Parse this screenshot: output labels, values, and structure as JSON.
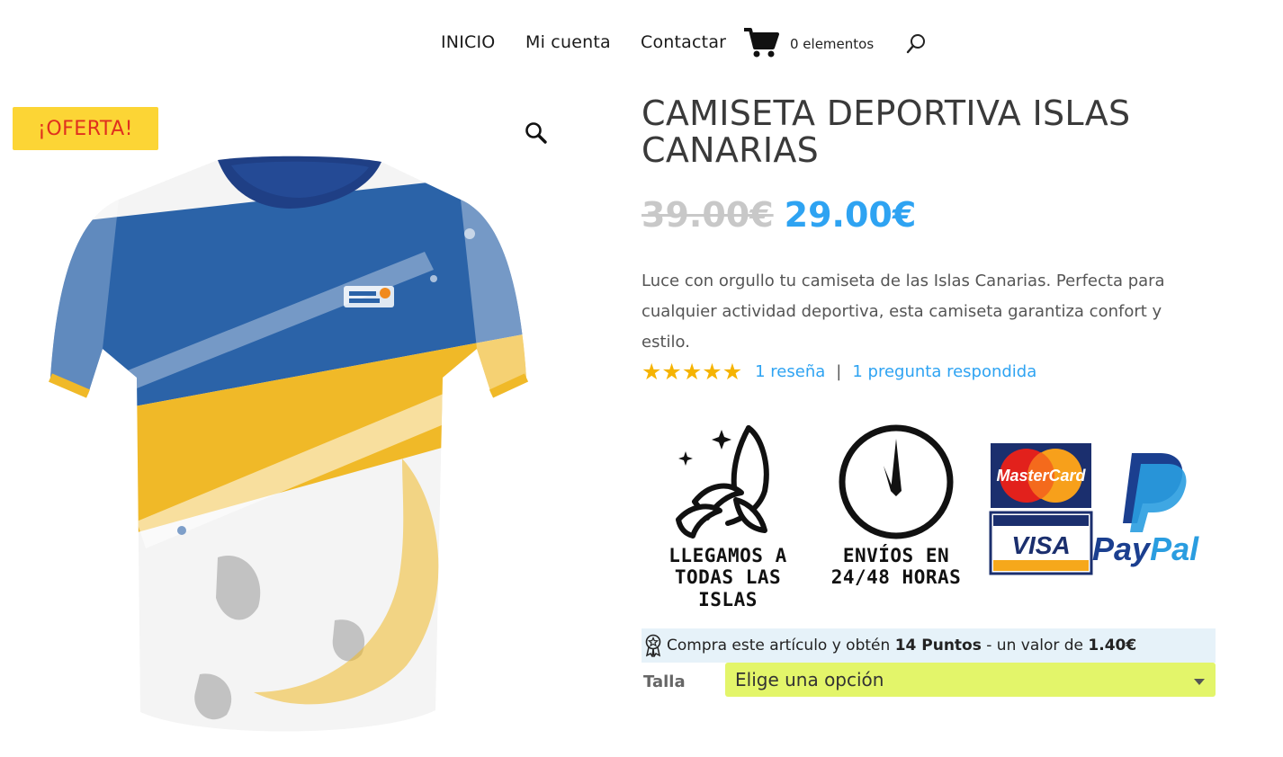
{
  "nav": {
    "items": [
      "INICIO",
      "Mi cuenta",
      "Contactar"
    ],
    "cart_count": "0 elementos"
  },
  "product": {
    "sale_badge": "¡OFERTA!",
    "title": "CAMISETA DEPORTIVA ISLAS CANARIAS",
    "price_old": "39.00€",
    "price_new": "29.00€",
    "description": "Luce con orgullo tu camiseta de las Islas Canarias. Perfecta para cualquier actividad deportiva, esta camiseta garantiza confort y estilo.",
    "rating": 5,
    "reviews_link": "1 reseña",
    "separator": "|",
    "questions_link": "1 pregunta respondida"
  },
  "badges": {
    "islands_line1": "LLEGAMOS A",
    "islands_line2": "TODAS LAS ISLAS",
    "shipping_line1": "ENVÍOS EN",
    "shipping_line2": "24/48 HORAS",
    "mastercard": "MasterCard",
    "visa": "VISA",
    "paypal_pay": "Pay",
    "paypal_pal": "Pal"
  },
  "points": {
    "prefix": "Compra este artículo y obtén ",
    "points": "14 Puntos",
    "middle": " - un valor de ",
    "value": "1.40€"
  },
  "variation": {
    "label": "Talla",
    "selected": "Elige una opción"
  },
  "colors": {
    "accent": "#2ea3f2",
    "sale_bg": "#fcd535",
    "sale_text": "#e0301e",
    "select_bg": "#e3f56a",
    "points_bg": "#e6f2f9",
    "shirt_blue": "#2b63a8",
    "shirt_yellow": "#f0b928"
  }
}
